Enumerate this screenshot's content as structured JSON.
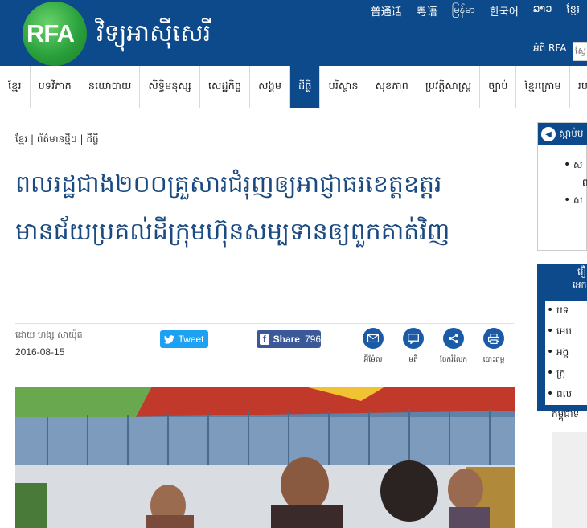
{
  "header": {
    "logo_text": "RFA",
    "site_name": "វិទ្យុអាស៊ីសេរី",
    "languages": [
      "普通话",
      "粤语",
      "မြန်မာ",
      "한국어",
      "ລາວ",
      "ខ្មែរ"
    ],
    "about_label": "អំពី RFA",
    "search_placeholder": "ស្វែ"
  },
  "nav": {
    "items": [
      "ខ្មែរ",
      "បទវិភាគ",
      "នយោបាយ",
      "សិទ្ធិមនុស្ស",
      "សេដ្ឋកិច្ច",
      "សង្គម",
      "ដីធ្លី",
      "បរិស្ថាន",
      "សុខភាព",
      "ប្រវត្តិសាស្ត្រ",
      "ច្បាប់",
      "ខ្មែរក្រោម",
      "របកគំ"
    ],
    "active_index": 6
  },
  "article": {
    "breadcrumb": "ខ្មែរ | ព័ត៌មានថ្មីៗ | ដីធ្លី",
    "title": "ពលរដ្ឋជាង២០០គ្រួសារជំរុញឲ្យអាជ្ញាធរខេត្តឧត្តរមានជ័យប្រគល់ដីក្រុមហ៊ុនសម្បទានឲ្យពួកគាត់វិញ",
    "byline": "ដោយ ហង្ស សាយ៉ុត",
    "date": "2016-08-15",
    "tweet_label": "Tweet",
    "share_label": "Share",
    "share_count": "796",
    "tools": [
      {
        "icon": "email-icon",
        "label": "អ៊ីម៉ែល"
      },
      {
        "icon": "comment-icon",
        "label": "មតិ"
      },
      {
        "icon": "share-icon",
        "label": "ចែករំលែក"
      },
      {
        "icon": "print-icon",
        "label": "បោះពុម្ព"
      }
    ]
  },
  "sidebar": {
    "listen_title": "ស្ដាប់ប",
    "listen_items": [
      "ស",
      "ស"
    ],
    "listen_sub": [
      "ព"
    ],
    "popular_title": "រឿ",
    "popular_sub": "អេក",
    "popular_items": [
      "បទ",
      "មេប",
      "អង្គ",
      "ក្រុ",
      "ពល"
    ],
    "caption": "កម្ពុជាទ"
  },
  "colors": {
    "brand_blue": "#0d4a8b",
    "title_blue": "#1a4a82",
    "tweet_blue": "#1da1f2",
    "facebook_blue": "#3b5998"
  }
}
